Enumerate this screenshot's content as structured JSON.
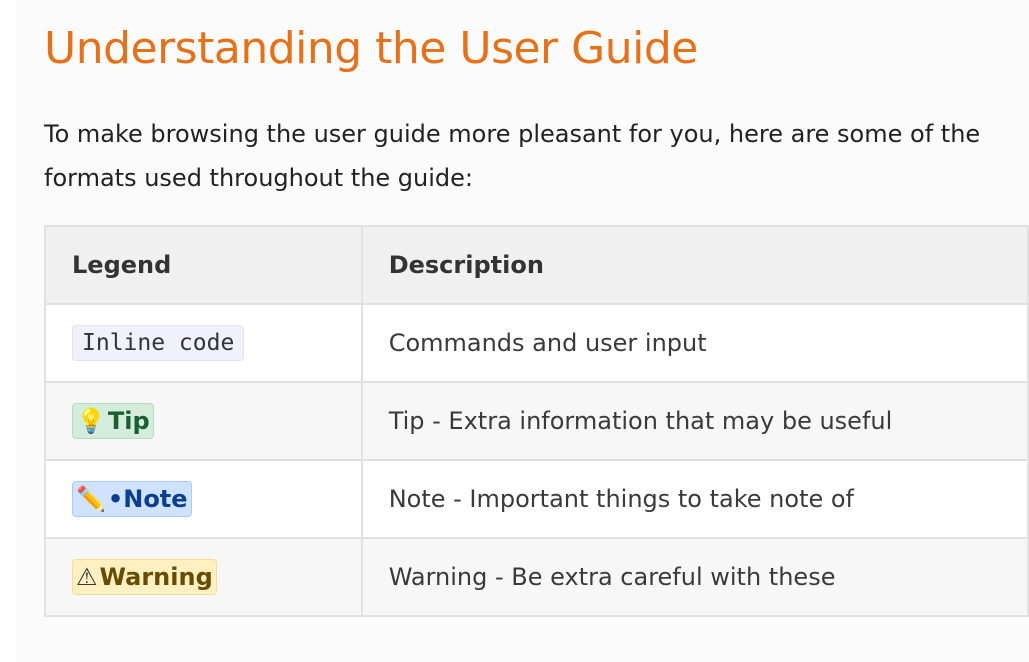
{
  "page": {
    "title": "Understanding the User Guide",
    "intro_line1": "To make browsing the user guide more pleasant for you, here are some of the",
    "intro_line2": "formats used throughout the guide:"
  },
  "table": {
    "headers": {
      "legend": "Legend",
      "description": "Description"
    },
    "rows": [
      {
        "kind": "code",
        "label": "Inline code",
        "description": "Commands and user input"
      },
      {
        "kind": "tip",
        "icon": "💡",
        "icon_name": "lightbulb-icon",
        "label": "Tip",
        "description": "Tip - Extra information that may be useful"
      },
      {
        "kind": "note",
        "icon": "✏️",
        "icon_name": "pencil-icon",
        "label": "•Note",
        "description": "Note - Important things to take note of"
      },
      {
        "kind": "warning",
        "icon": "⚠",
        "icon_name": "warning-icon",
        "label": "Warning",
        "description": "Warning - Be extra careful with these"
      }
    ]
  },
  "colors": {
    "title": "#e5711a",
    "tip_bg": "#d3ecdc",
    "note_bg": "#cfe2ff",
    "warning_bg": "#fff0c2"
  }
}
